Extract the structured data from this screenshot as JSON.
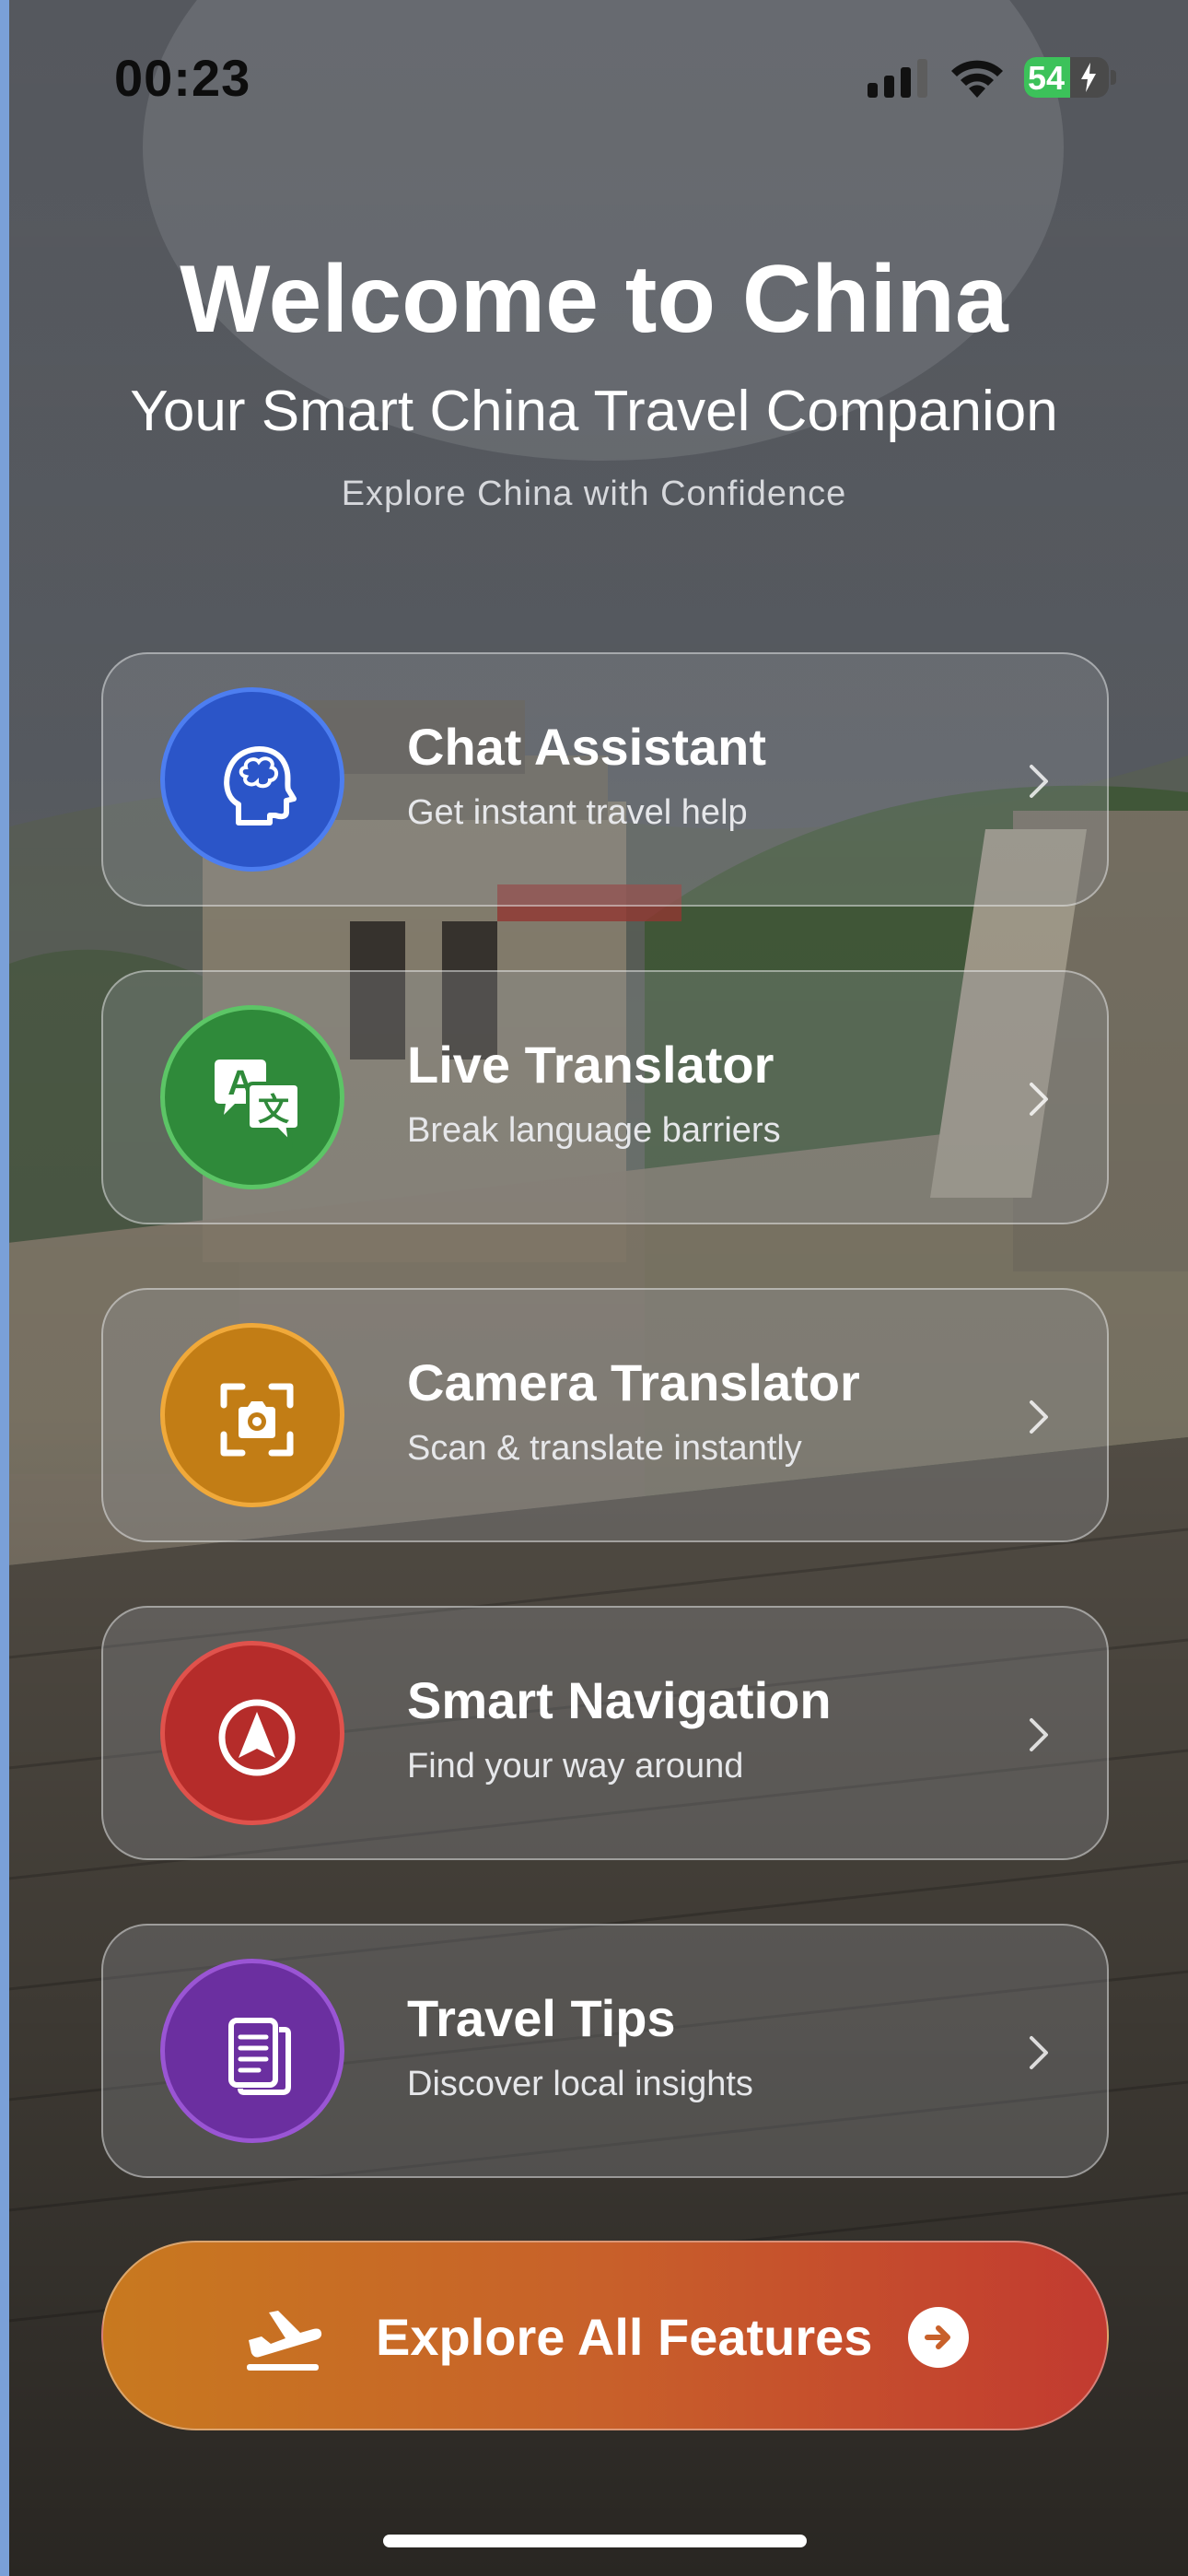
{
  "status_bar": {
    "time": "00:23",
    "battery_percent": "54",
    "battery_level": 0.54,
    "charging": true,
    "icons": [
      "signal-icon",
      "wifi-icon",
      "battery-icon"
    ]
  },
  "header": {
    "title": "Welcome to China",
    "subtitle": "Your Smart China Travel Companion",
    "tagline": "Explore China with Confidence"
  },
  "features": [
    {
      "title": "Chat Assistant",
      "subtitle": "Get instant travel help",
      "icon": "brain-head-icon",
      "color": "#2b55c8"
    },
    {
      "title": "Live Translator",
      "subtitle": "Break language barriers",
      "icon": "translate-icon",
      "color": "#2f8a3a"
    },
    {
      "title": "Camera Translator",
      "subtitle": "Scan & translate instantly",
      "icon": "camera-scan-icon",
      "color": "#c27d15"
    },
    {
      "title": "Smart Navigation",
      "subtitle": "Find your way around",
      "icon": "navigation-arrow-icon",
      "color": "#b52c2a"
    },
    {
      "title": "Travel Tips",
      "subtitle": "Discover local insights",
      "icon": "document-icon",
      "color": "#6b2fa0"
    }
  ],
  "cta": {
    "label": "Explore All Features",
    "icon_left": "airplane-takeoff-icon",
    "icon_right": "arrow-right-circle-icon",
    "gradient": [
      "#c8791f",
      "#c23a30"
    ]
  }
}
